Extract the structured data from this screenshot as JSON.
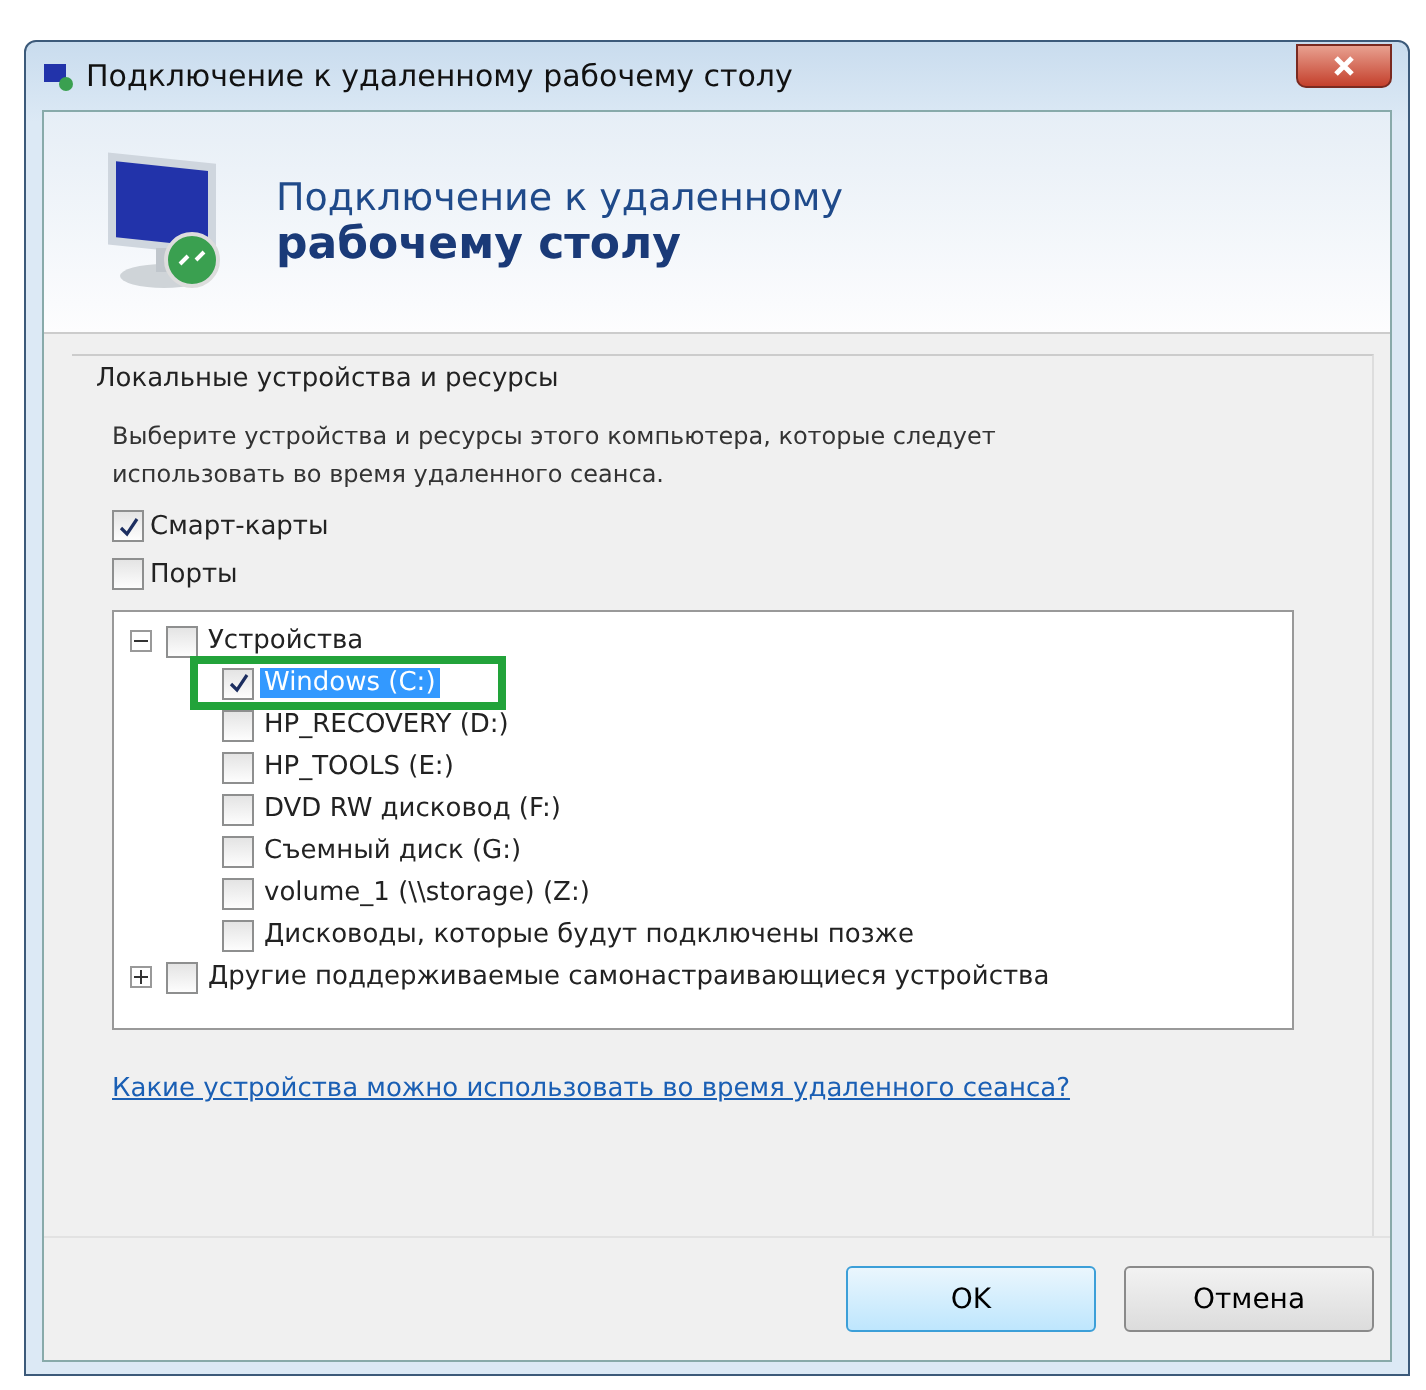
{
  "window": {
    "title": "Подключение к удаленному рабочему столу"
  },
  "header": {
    "line_1": "Подключение к удаленному",
    "line_2": "рабочему столу"
  },
  "group": {
    "title": "Локальные устройства и ресурсы",
    "description": "Выберите устройства и ресурсы этого компьютера, которые следует использовать во время удаленного сеанса.",
    "options": [
      {
        "label": "Смарт-карты",
        "checked": true
      },
      {
        "label": "Порты",
        "checked": false
      }
    ],
    "tree": [
      {
        "label": "Устройства",
        "checked": false,
        "expanded": true,
        "selected": false,
        "children": [
          {
            "label": "Windows (C:)",
            "checked": true,
            "selected": true,
            "highlighted": true
          },
          {
            "label": "HP_RECOVERY (D:)",
            "checked": false,
            "selected": false
          },
          {
            "label": "HP_TOOLS (E:)",
            "checked": false,
            "selected": false
          },
          {
            "label": "DVD RW дисковод (F:)",
            "checked": false,
            "selected": false
          },
          {
            "label": "Съемный диск (G:)",
            "checked": false,
            "selected": false
          },
          {
            "label": "volume_1 (\\\\storage) (Z:)",
            "checked": false,
            "selected": false
          },
          {
            "label": "Дисководы, которые будут подключены позже",
            "checked": false,
            "selected": false
          }
        ]
      },
      {
        "label": "Другие поддерживаемые самонастраивающиеся устройства",
        "checked": false,
        "expanded": false,
        "selected": false
      }
    ],
    "link": "Какие устройства можно использовать во время удаленного сеанса?"
  },
  "buttons": [
    {
      "label": "OK",
      "default": true
    },
    {
      "label": "Отмена",
      "default": false
    }
  ]
}
